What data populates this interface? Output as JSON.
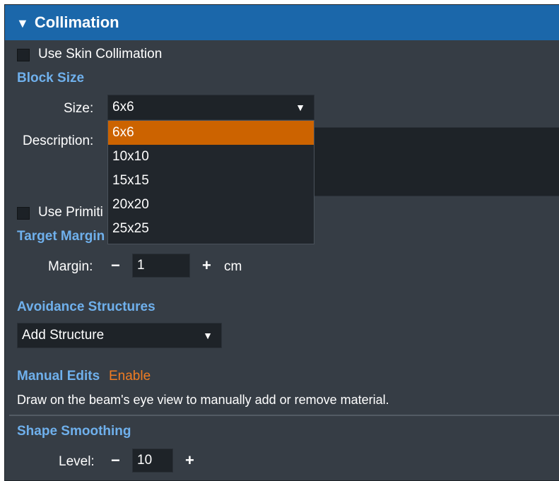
{
  "header": {
    "title": "Collimation",
    "collapse_icon": "triangle-down-icon"
  },
  "skin": {
    "label": "Use Skin Collimation",
    "checked": false
  },
  "block_size": {
    "title": "Block Size",
    "size_label": "Size:",
    "size_value": "6x6",
    "description_label": "Description:",
    "options": [
      "6x6",
      "10x10",
      "15x15",
      "20x20",
      "25x25"
    ],
    "selected_option": "6x6"
  },
  "primitive": {
    "label": "Use Primiti",
    "checked": false
  },
  "target_margin": {
    "title": "Target Margin",
    "margin_label": "Margin:",
    "value": "1",
    "unit": "cm",
    "minus_label": "−",
    "plus_label": "+"
  },
  "avoidance": {
    "title": "Avoidance Structures",
    "dropdown_value": "Add Structure"
  },
  "manual_edits": {
    "title": "Manual Edits",
    "enable_label": "Enable",
    "description": "Draw on the beam's eye view to manually add or remove material."
  },
  "smoothing": {
    "title": "Shape Smoothing",
    "level_label": "Level:",
    "value": "10",
    "minus_label": "−",
    "plus_label": "+"
  },
  "colors": {
    "header": "#1b67aa",
    "panel": "#363d45",
    "section_title": "#6fb0ec",
    "accent": "#cc6300",
    "link": "#f07c22"
  }
}
